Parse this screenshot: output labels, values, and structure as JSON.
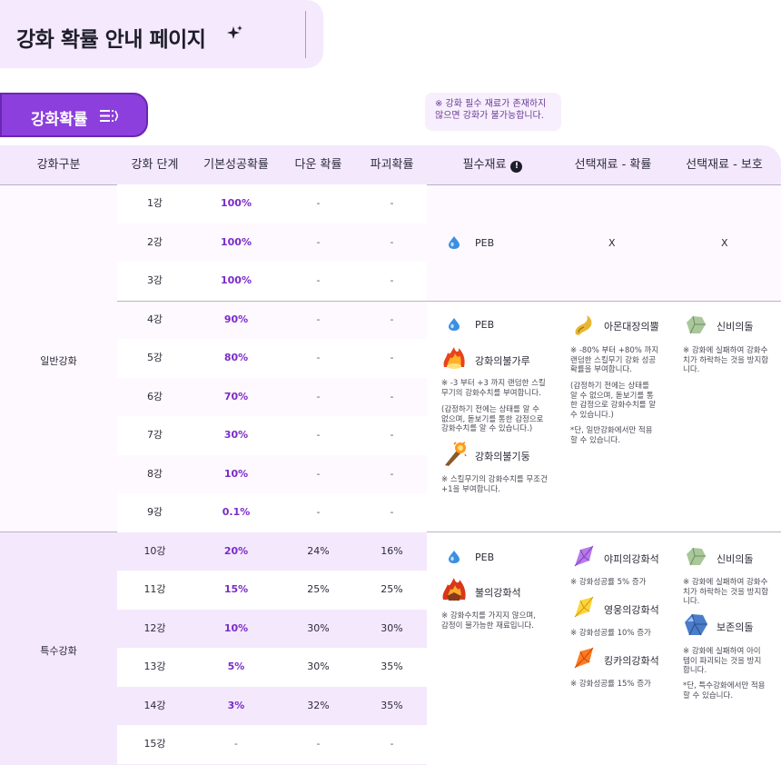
{
  "page": {
    "title": "강화 확률 안내 페이지",
    "tab_label": "강화확률",
    "tooltip": "※ 강화 필수 재료가 존재하지 않으면 강화가 불가능합니다."
  },
  "table": {
    "headers": [
      "강화구분",
      "강화 단계",
      "기본성공확률",
      "다운 확률",
      "파괴확률",
      "필수재료",
      "선택재료 - 확률",
      "선택재료 - 보호"
    ],
    "header_info_icon": "!",
    "sections": [
      {
        "category": "일반강화",
        "rows": [
          {
            "stage": "1강",
            "rate": "100%",
            "down": "-",
            "destroy": "-"
          },
          {
            "stage": "2강",
            "rate": "100%",
            "down": "-",
            "destroy": "-"
          },
          {
            "stage": "3강",
            "rate": "100%",
            "down": "-",
            "destroy": "-"
          },
          {
            "stage": "4강",
            "rate": "90%",
            "down": "-",
            "destroy": "-"
          },
          {
            "stage": "5강",
            "rate": "80%",
            "down": "-",
            "destroy": "-"
          },
          {
            "stage": "6강",
            "rate": "70%",
            "down": "-",
            "destroy": "-"
          },
          {
            "stage": "7강",
            "rate": "30%",
            "down": "-",
            "destroy": "-"
          },
          {
            "stage": "8강",
            "rate": "10%",
            "down": "-",
            "destroy": "-"
          },
          {
            "stage": "9강",
            "rate": "0.1%",
            "down": "-",
            "destroy": "-"
          }
        ]
      },
      {
        "category": "특수강화",
        "rows": [
          {
            "stage": "10강",
            "rate": "20%",
            "down": "24%",
            "destroy": "16%"
          },
          {
            "stage": "11강",
            "rate": "15%",
            "down": "25%",
            "destroy": "25%"
          },
          {
            "stage": "12강",
            "rate": "10%",
            "down": "30%",
            "destroy": "30%"
          },
          {
            "stage": "13강",
            "rate": "5%",
            "down": "30%",
            "destroy": "35%"
          },
          {
            "stage": "14강",
            "rate": "3%",
            "down": "32%",
            "destroy": "35%"
          },
          {
            "stage": "15강",
            "rate": "-",
            "down": "-",
            "destroy": "-"
          }
        ]
      }
    ]
  },
  "materials": {
    "group1": {
      "required": "PEB",
      "opt_rate": "X",
      "opt_protect": "X"
    },
    "group2": {
      "req_peb": "PEB",
      "req_powder": "강화의불가루",
      "req_powder_note": "※ -3 부터  +3 까지 랜덤한 스킬\n무기의 강화수치를 부여합니다.",
      "req_powder_note2": "(감정하기 전에는 상태를 알 수\n없으며, 돋보기를 통한 감정으로\n강화수치를 알 수 있습니다.)",
      "req_pillar": "강화의불기둥",
      "req_pillar_note": "※ 스킬무기의 강화수치를 무조건\n+1을 부여합니다.",
      "opt_rate_name": "아몬대장의뿔",
      "opt_rate_note": "※ -80% 부터 +80% 까지\n랜덤한 스킬무기 강화 성공\n확률을 부여합니다.",
      "opt_rate_note2": "(감정하기 전에는 상태를\n알 수 없으며, 돋보기를 통\n한 감정으로 강화수치를 알\n수 있습니다.)",
      "opt_rate_note3": "*단, 일반강화에서만 적용\n할 수 있습니다.",
      "opt_protect_name": "신비의돌",
      "opt_protect_note": "※ 강화에 실패하여 강화수\n치가 하락하는 것을 방지합\n니다."
    },
    "group3": {
      "req_peb": "PEB",
      "req_stone": "불의강화석",
      "req_stone_note": "※ 강화수치를 가지지 않으며,\n감정이 불가능한 재료입니다.",
      "opt1_name": "야피의강화석",
      "opt1_note": "※ 강화성공률 5% 증가",
      "opt2_name": "영웅의강화석",
      "opt2_note": "※ 강화성공률 10% 증가",
      "opt3_name": "킹카의강화석",
      "opt3_note": "※ 강화성공률 15% 증가",
      "prot1_name": "신비의돌",
      "prot1_note": "※ 강화에 실패하여 강화수\n치가 하락하는 것을 방지합\n니다.",
      "prot2_name": "보존의돌",
      "prot2_note": "※ 강화에 실패하여 아이\n템이 파괴되는 것을 방지\n합니다.",
      "prot2_note2": "*단, 특수강화에서만 적용\n할 수 있습니다."
    }
  },
  "colors": {
    "accent": "#8c3fdc",
    "rate_text": "#7a2bc8",
    "panel_bg": "#f4e8fd"
  }
}
